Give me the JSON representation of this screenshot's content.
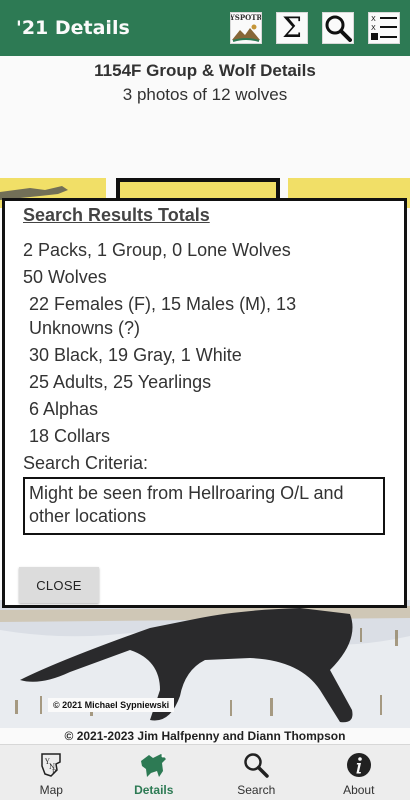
{
  "app_bar": {
    "title": "'21 Details",
    "logo_text": "YSPOTR",
    "actions": [
      {
        "icon": "yspotr-logo-icon"
      },
      {
        "icon": "sigma-totals-icon",
        "glyph": "Σ"
      },
      {
        "icon": "magnifier-search-icon"
      },
      {
        "icon": "checklist-filter-icon"
      }
    ]
  },
  "header": {
    "title": "1154F Group & Wolf Details",
    "subtitle": "3 photos of 12 wolves"
  },
  "dialog": {
    "title": "Search Results Totals",
    "lines": [
      "2 Packs, 1 Group, 0 Lone Wolves",
      "50 Wolves",
      "22 Females (F), 15 Males (M), 13",
      "Unknowns (?)",
      "30 Black, 19 Gray, 1 White",
      "25 Adults, 25 Yearlings",
      "6 Alphas",
      "18 Collars",
      "Search Criteria:"
    ],
    "criteria_text": "Might be seen from Hellroaring O/L and other locations",
    "close_label": "CLOSE"
  },
  "photo": {
    "credit": "© 2021 Michael Sypniewski"
  },
  "footer": {
    "copyright": "© 2021-2023 Jim Halfpenny and Diann Thompson"
  },
  "bottom_nav": {
    "items": [
      {
        "label": "Map",
        "icon": "ynp-map-icon",
        "active": false
      },
      {
        "label": "Details",
        "icon": "wolf-paw-icon",
        "active": true
      },
      {
        "label": "Search",
        "icon": "magnifier-icon",
        "active": false
      },
      {
        "label": "About",
        "icon": "info-icon",
        "active": false
      }
    ]
  },
  "colors": {
    "app_bar": "#2e7d56",
    "active_tab": "#2e7d56",
    "thumb_highlight": "#f6e46a"
  }
}
